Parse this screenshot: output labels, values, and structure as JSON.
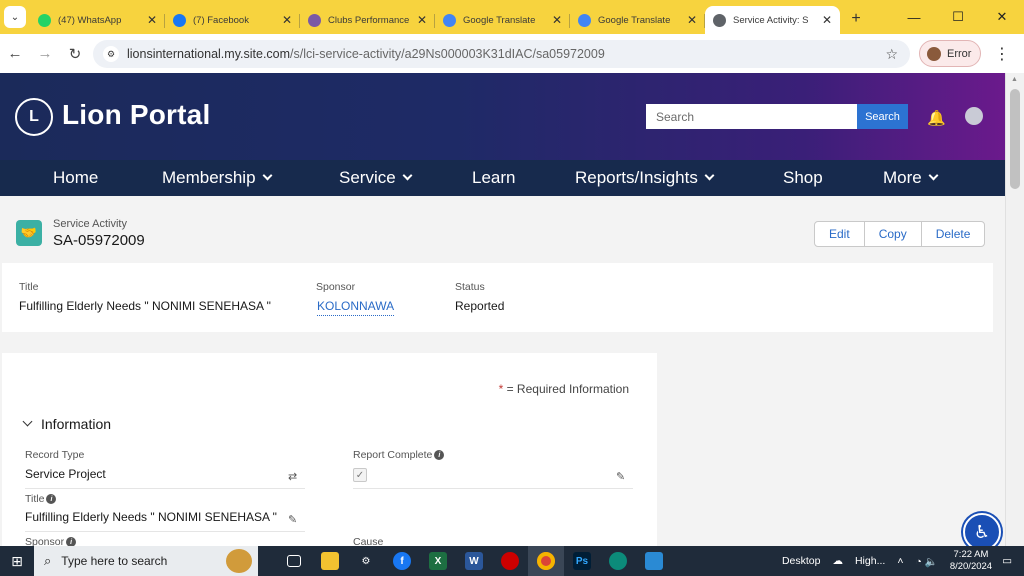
{
  "browser": {
    "tabs": [
      {
        "title": "(47) WhatsApp",
        "icon": "whatsapp-icon",
        "color": "#25d366"
      },
      {
        "title": "(7) Facebook",
        "icon": "facebook-icon",
        "color": "#1877f2"
      },
      {
        "title": "Clubs Performance",
        "icon": "lions-icon",
        "color": "#7b5aa6"
      },
      {
        "title": "Google Translate",
        "icon": "translate-icon",
        "color": "#4285f4"
      },
      {
        "title": "Google Translate",
        "icon": "translate-icon",
        "color": "#4285f4"
      },
      {
        "title": "Service Activity: S",
        "icon": "globe-icon",
        "color": "#5f6368"
      }
    ],
    "url_host": "lionsinternational.my.site.com",
    "url_path": "/s/lci-service-activity/a29Ns000003K31dIAC/sa05972009",
    "profile_status": "Error"
  },
  "portal": {
    "logo_text": "Lion Portal",
    "search_placeholder": "Search",
    "search_button": "Search",
    "nav": [
      "Home",
      "Membership",
      "Service",
      "Learn",
      "Reports/Insights",
      "Shop",
      "More"
    ]
  },
  "record": {
    "type_label": "Service Activity",
    "id": "SA-05972009",
    "actions": [
      "Edit",
      "Copy",
      "Delete"
    ],
    "highlights": {
      "title_label": "Title",
      "title_value": "Fulfilling Elderly Needs \" NONIMI SENEHASA \"",
      "sponsor_label": "Sponsor",
      "sponsor_value": "KOLONNAWA",
      "status_label": "Status",
      "status_value": "Reported"
    }
  },
  "details": {
    "required_marker": "*",
    "required_text": " = Required Information",
    "section_title": "Information",
    "record_type_label": "Record Type",
    "record_type_value": "Service Project",
    "report_complete_label": "Report Complete",
    "title_label": "Title",
    "title_value": "Fulfilling Elderly Needs \" NONIMI SENEHASA \"",
    "sponsor_label": "Sponsor",
    "cause_label": "Cause"
  },
  "taskbar": {
    "search_placeholder": "Type here to search",
    "desktop_label": "Desktop",
    "weather": "High...",
    "time": "7:22 AM",
    "date": "8/20/2024"
  }
}
